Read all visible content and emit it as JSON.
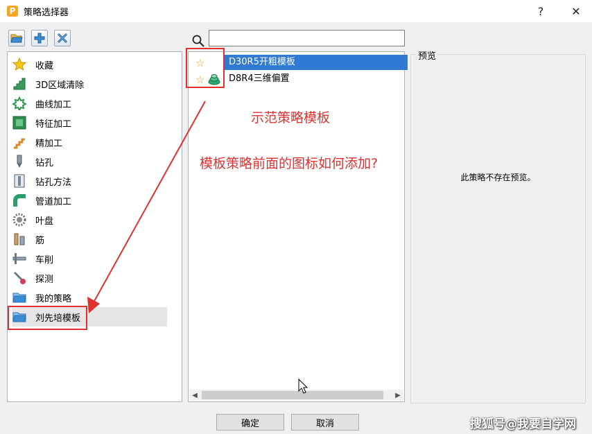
{
  "window": {
    "title": "策略选择器",
    "help": "?",
    "close": "✕",
    "app_icon_letter": "P"
  },
  "toolbar": {
    "buttons": [
      "open-folder-icon",
      "add-icon",
      "remove-tools-icon"
    ]
  },
  "tree": {
    "items": [
      {
        "label": "收藏",
        "icon": "star-icon"
      },
      {
        "label": "3D区域清除",
        "icon": "area-clear-icon"
      },
      {
        "label": "曲线加工",
        "icon": "curve-icon"
      },
      {
        "label": "特征加工",
        "icon": "feature-icon"
      },
      {
        "label": "精加工",
        "icon": "finishing-icon"
      },
      {
        "label": "钻孔",
        "icon": "drill-icon"
      },
      {
        "label": "钻孔方法",
        "icon": "drill-method-icon"
      },
      {
        "label": "管道加工",
        "icon": "pipe-icon"
      },
      {
        "label": "叶盘",
        "icon": "blisk-icon"
      },
      {
        "label": "筋",
        "icon": "rib-icon"
      },
      {
        "label": "车削",
        "icon": "turning-icon"
      },
      {
        "label": "探测",
        "icon": "probe-icon"
      },
      {
        "label": "我的策略",
        "icon": "folder-icon"
      },
      {
        "label": "刘先培模板",
        "icon": "folder-icon"
      }
    ],
    "selected": "刘先培模板"
  },
  "search": {
    "placeholder": "",
    "value": ""
  },
  "strategy_list": {
    "rows": [
      {
        "label": "D30R5开粗模板",
        "selected": true
      },
      {
        "label": "D8R4三维偏置",
        "selected": false
      }
    ]
  },
  "preview": {
    "title": "预览",
    "message": "此策略不存在预览。"
  },
  "buttons": {
    "ok": "确定",
    "cancel": "取消"
  },
  "annotations": {
    "line1": "示范策略模板",
    "line2": "模板策略前面的图标如何添加?"
  },
  "watermark": "搜狐号@我要自学网",
  "colors": {
    "selection": "#2f7bd4",
    "annotation": "#e03030",
    "folder": "#3b8ed6"
  }
}
